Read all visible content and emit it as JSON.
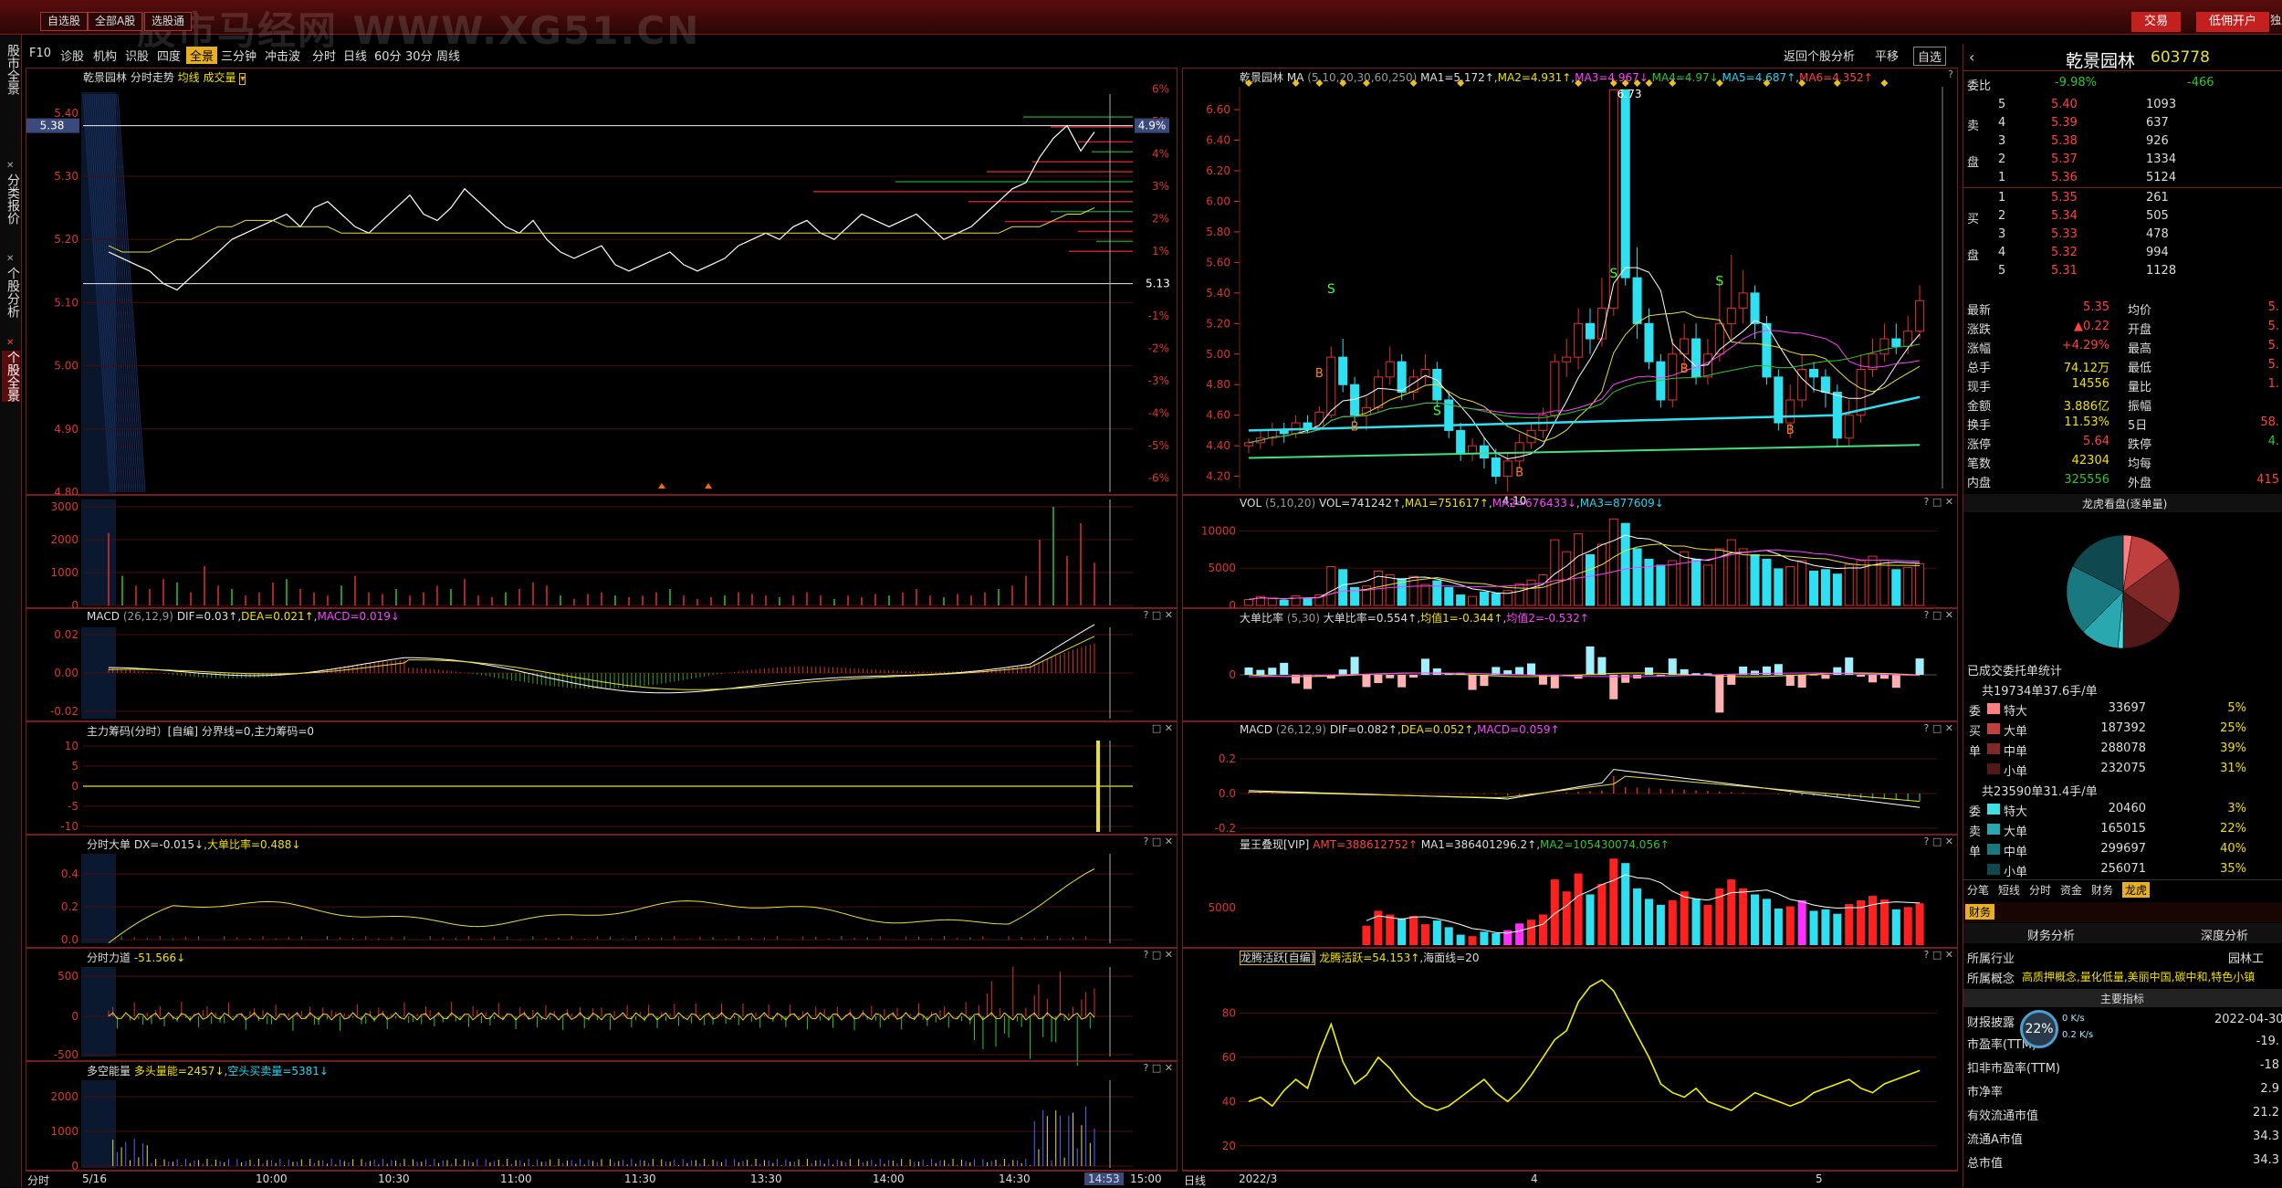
{
  "topbar": {
    "watermark": "股市马经网 WWW.XG51.CN",
    "btn_zixuan": "自选股",
    "btn_quanbu": "全部A股",
    "btn_yingxiao": "选股通",
    "btn_jiaoyi": "交易",
    "btn_kaihu": "低佣开户",
    "btn_more": "独立"
  },
  "lefttabs": {
    "tab1": "股市全景",
    "tab2": "分类报价",
    "tab3": "个股分析",
    "tab4": "个股全景"
  },
  "toolbar": {
    "items": [
      "F10",
      "诊股",
      "机构",
      "识股",
      "四度",
      "全景",
      "三分钟",
      "冲击波",
      "分时",
      "日线",
      "60分",
      "30分",
      "周线"
    ],
    "selected": "全景",
    "return": "返回个股分析",
    "pingyi": "平移",
    "zixuan": "自选"
  },
  "intraday": {
    "title": "乾景园林 分时走势",
    "sub": "均线 成交量",
    "price_labels": [
      "5.40",
      "5.30",
      "5.20",
      "5.10",
      "5.00",
      "4.90",
      "4.80"
    ],
    "current_price_tag": "5.38",
    "pct_labels": [
      "6%",
      "5%",
      "4%",
      "3%",
      "2%",
      "1%",
      "-1%",
      "-2%",
      "-3%",
      "-4%",
      "-5%",
      "-6%"
    ],
    "pct_tag": "4.9%",
    "ref_price": "5.13",
    "ref_price_val": 5.13,
    "price_series": [
      5.18,
      5.17,
      5.16,
      5.15,
      5.13,
      5.12,
      5.14,
      5.16,
      5.18,
      5.2,
      5.21,
      5.22,
      5.23,
      5.24,
      5.22,
      5.25,
      5.26,
      5.24,
      5.22,
      5.21,
      5.23,
      5.25,
      5.27,
      5.24,
      5.23,
      5.25,
      5.28,
      5.26,
      5.24,
      5.22,
      5.21,
      5.23,
      5.2,
      5.18,
      5.17,
      5.18,
      5.19,
      5.16,
      5.15,
      5.16,
      5.17,
      5.18,
      5.16,
      5.15,
      5.16,
      5.17,
      5.19,
      5.2,
      5.21,
      5.2,
      5.22,
      5.23,
      5.21,
      5.2,
      5.22,
      5.24,
      5.23,
      5.22,
      5.23,
      5.24,
      5.22,
      5.2,
      5.21,
      5.22,
      5.24,
      5.26,
      5.28,
      5.29,
      5.33,
      5.36,
      5.38,
      5.34,
      5.37
    ],
    "avg_series": [
      5.19,
      5.18,
      5.18,
      5.18,
      5.19,
      5.2,
      5.2,
      5.21,
      5.22,
      5.22,
      5.23,
      5.23,
      5.23,
      5.22,
      5.22,
      5.22,
      5.22,
      5.21,
      5.21,
      5.21,
      5.21,
      5.21,
      5.21,
      5.21,
      5.21,
      5.21,
      5.21,
      5.21,
      5.21,
      5.21,
      5.21,
      5.21,
      5.21,
      5.21,
      5.21,
      5.21,
      5.21,
      5.21,
      5.21,
      5.21,
      5.21,
      5.21,
      5.21,
      5.21,
      5.21,
      5.21,
      5.21,
      5.21,
      5.21,
      5.21,
      5.21,
      5.21,
      5.21,
      5.21,
      5.21,
      5.21,
      5.21,
      5.21,
      5.21,
      5.21,
      5.21,
      5.21,
      5.21,
      5.21,
      5.21,
      5.21,
      5.22,
      5.22,
      5.22,
      5.23,
      5.24,
      5.24,
      5.25
    ],
    "vol_labels": [
      "3000",
      "2000",
      "1000",
      "0"
    ],
    "vol_ylim": 3000,
    "vol_series": [
      2200,
      900,
      600,
      500,
      800,
      700,
      400,
      1200,
      600,
      500,
      300,
      400,
      700,
      800,
      500,
      400,
      300,
      600,
      900,
      400,
      350,
      500,
      300,
      400,
      600,
      500,
      800,
      300,
      250,
      400,
      500,
      700,
      600,
      300,
      200,
      350,
      400,
      300,
      250,
      300,
      400,
      500,
      300,
      200,
      250,
      300,
      400,
      350,
      300,
      250,
      300,
      400,
      300,
      200,
      300,
      250,
      350,
      300,
      400,
      500,
      300,
      250,
      350,
      300,
      400,
      500,
      600,
      900,
      2000,
      3000,
      1500,
      2500,
      1300
    ],
    "macd_title": "MACD",
    "macd_params": "(26,12,9)",
    "macd_dif": "DIF=0.03↑",
    "macd_dea": "DEA=0.021↑",
    "macd_val": "MACD=0.019↓",
    "macd_labels": [
      "0.02",
      "0.00",
      "-0.02"
    ],
    "zl_title": "主力筹码(分时）[自编]",
    "zl_sub": "分界线=0,主力筹码=0",
    "zl_labels": [
      "10",
      "5",
      "0",
      "-5",
      "-10"
    ],
    "dd_title": "分时大单",
    "dd_dx": "DX=-0.015↓",
    "dd_bili": "大单比率=0.488↓",
    "dd_labels": [
      "0.4",
      "0.2",
      "0.0"
    ],
    "ld_title": "分时力道",
    "ld_val": "-51.566↓",
    "ld_labels": [
      "500",
      "0",
      "-500"
    ],
    "dk_title": "多空能量",
    "dk_val": "多头量能=2457↓",
    "dk_kong": "空头买卖量=5381↓",
    "dk_labels": [
      "2000",
      "1000",
      "0"
    ],
    "time_labels": [
      "5/16",
      "10:00",
      "10:30",
      "11:00",
      "11:30",
      "13:30",
      "14:00",
      "14:30",
      "14:53",
      "15:00"
    ],
    "time_prefix": "分时"
  },
  "daily": {
    "title": "乾景园林",
    "ma_label": "MA",
    "ma_params": "(5,10,20,30,60,250)",
    "ma1": "MA1=5.172↑",
    "ma2": "MA2=4.931↑",
    "ma3": "MA3=4.967↓",
    "ma4": "MA4=4.97↓",
    "ma5": "MA5=4.687↑",
    "ma6": "MA6=4.352↑",
    "price_labels": [
      "6.60",
      "6.40",
      "6.20",
      "6.00",
      "5.80",
      "5.60",
      "5.40",
      "5.20",
      "5.00",
      "4.80",
      "4.60",
      "4.40",
      "4.20"
    ],
    "high_mark": "6.73",
    "low_mark": "4.10",
    "vol_title": "VOL",
    "vol_params": "(5,10,20)",
    "vol_val": "VOL=741242↑",
    "vol_ma1": "MA1=751617↑",
    "vol_ma2": "MA2=676433↓",
    "vol_ma3": "MA3=877609↓",
    "vol_labels": [
      "10000",
      "5000",
      "0"
    ],
    "dd_title": "大单比率",
    "dd_params": "(5,30)",
    "dd_val": "大单比率=0.554↑",
    "dd_j1": "均值1=-0.344↑",
    "dd_j2": "均值2=-0.532↑",
    "dd_labels": [
      "0"
    ],
    "macd_title": "MACD",
    "macd_params": "(26,12,9)",
    "macd_dif": "DIF=0.082↑",
    "macd_dea": "DEA=0.052↑",
    "macd_val": "MACD=0.059↑",
    "macd_labels": [
      "0.2",
      "0.0",
      "-0.2"
    ],
    "lw_title": "量王叠现[VIP]",
    "lw_amt": "AMT=388612752↑",
    "lw_ma1": "MA1=386401296.2↑",
    "lw_ma2": "MA2=105430074.056↑",
    "lw_labels": [
      "5000"
    ],
    "lt_title": "龙腾活跃[自编]",
    "lt_val": "龙腾活跃=54.153↑",
    "lt_sea": "海面线=20",
    "lt_labels": [
      "80",
      "60",
      "40",
      "20"
    ],
    "date_labels": [
      "2022/3",
      "4",
      "5"
    ],
    "date_prefix": "日线",
    "candles": [
      [
        4.4,
        4.42,
        4.35,
        4.45
      ],
      [
        4.42,
        4.45,
        4.38,
        4.5
      ],
      [
        4.45,
        4.5,
        4.4,
        4.55
      ],
      [
        4.5,
        4.48,
        4.42,
        4.55
      ],
      [
        4.48,
        4.55,
        4.45,
        4.6
      ],
      [
        4.55,
        4.52,
        4.48,
        4.6
      ],
      [
        4.52,
        4.62,
        4.5,
        4.66
      ],
      [
        4.6,
        4.98,
        4.58,
        5.05
      ],
      [
        4.98,
        4.8,
        4.75,
        5.1
      ],
      [
        4.8,
        4.6,
        4.55,
        4.85
      ],
      [
        4.6,
        4.65,
        4.5,
        4.72
      ],
      [
        4.65,
        4.85,
        4.62,
        4.9
      ],
      [
        4.85,
        4.95,
        4.8,
        5.05
      ],
      [
        4.95,
        4.75,
        4.7,
        5.0
      ],
      [
        4.75,
        4.85,
        4.7,
        4.9
      ],
      [
        4.85,
        4.9,
        4.8,
        5.0
      ],
      [
        4.9,
        4.7,
        4.65,
        4.95
      ],
      [
        4.7,
        4.5,
        4.45,
        4.75
      ],
      [
        4.5,
        4.35,
        4.3,
        4.55
      ],
      [
        4.35,
        4.4,
        4.3,
        4.45
      ],
      [
        4.4,
        4.32,
        4.25,
        4.45
      ],
      [
        4.32,
        4.2,
        4.15,
        4.38
      ],
      [
        4.2,
        4.3,
        4.1,
        4.35
      ],
      [
        4.3,
        4.42,
        4.25,
        4.48
      ],
      [
        4.42,
        4.5,
        4.38,
        4.55
      ],
      [
        4.5,
        4.6,
        4.45,
        4.65
      ],
      [
        4.6,
        4.95,
        4.58,
        5.0
      ],
      [
        4.95,
        4.98,
        4.85,
        5.1
      ],
      [
        4.98,
        5.2,
        4.9,
        5.3
      ],
      [
        5.2,
        5.1,
        5.0,
        5.3
      ],
      [
        5.1,
        5.3,
        5.05,
        5.5
      ],
      [
        5.3,
        6.73,
        5.25,
        6.73
      ],
      [
        6.73,
        5.5,
        5.45,
        6.73
      ],
      [
        5.5,
        5.2,
        5.1,
        5.7
      ],
      [
        5.2,
        4.95,
        4.9,
        5.3
      ],
      [
        4.95,
        4.7,
        4.65,
        5.0
      ],
      [
        4.7,
        5.0,
        4.65,
        5.1
      ],
      [
        5.0,
        5.1,
        4.9,
        5.2
      ],
      [
        5.1,
        4.85,
        4.8,
        5.2
      ],
      [
        4.85,
        5.0,
        4.8,
        5.1
      ],
      [
        5.0,
        5.2,
        4.95,
        5.5
      ],
      [
        5.2,
        5.3,
        5.1,
        5.65
      ],
      [
        5.3,
        5.4,
        5.2,
        5.55
      ],
      [
        5.4,
        5.2,
        5.1,
        5.45
      ],
      [
        5.2,
        4.85,
        4.8,
        5.25
      ],
      [
        4.85,
        4.55,
        4.5,
        4.9
      ],
      [
        4.55,
        4.7,
        4.45,
        4.8
      ],
      [
        4.7,
        4.9,
        4.65,
        5.0
      ],
      [
        4.9,
        4.85,
        4.75,
        4.95
      ],
      [
        4.85,
        4.75,
        4.65,
        4.9
      ],
      [
        4.75,
        4.45,
        4.4,
        4.8
      ],
      [
        4.45,
        4.6,
        4.4,
        4.7
      ],
      [
        4.6,
        4.9,
        4.55,
        5.0
      ],
      [
        4.9,
        5.0,
        4.85,
        5.1
      ],
      [
        5.0,
        5.1,
        4.95,
        5.2
      ],
      [
        5.1,
        5.05,
        5.0,
        5.2
      ],
      [
        5.05,
        5.15,
        5.0,
        5.25
      ],
      [
        5.15,
        5.35,
        5.1,
        5.45
      ]
    ],
    "vol": [
      800,
      1200,
      900,
      700,
      1300,
      1000,
      1400,
      5200,
      4800,
      2400,
      2600,
      4600,
      4100,
      3600,
      3900,
      2800,
      3300,
      2400,
      1400,
      1200,
      1800,
      1600,
      2000,
      2900,
      3400,
      4100,
      8800,
      7200,
      9600,
      6800,
      8200,
      11600,
      11000,
      7600,
      6200,
      5400,
      6000,
      7200,
      6200,
      5400,
      7600,
      8800,
      7600,
      6800,
      6200,
      4900,
      5200,
      6000,
      4600,
      4800,
      4200,
      5500,
      6000,
      6600,
      6100,
      4800,
      5100,
      5600
    ],
    "lt": [
      40,
      42,
      38,
      45,
      50,
      46,
      62,
      75,
      58,
      48,
      52,
      60,
      55,
      48,
      42,
      38,
      36,
      38,
      42,
      46,
      50,
      44,
      40,
      45,
      52,
      60,
      68,
      72,
      85,
      92,
      95,
      90,
      80,
      70,
      60,
      48,
      44,
      42,
      46,
      40,
      38,
      36,
      40,
      44,
      42,
      40,
      38,
      40,
      44,
      46,
      48,
      50,
      46,
      44,
      48,
      50,
      52,
      54
    ]
  },
  "quote": {
    "name": "乾景园林",
    "code": "603778",
    "weibi_label": "委比",
    "weibi_val": "-9.98%",
    "weicha": "-466",
    "sell": [
      [
        "5.40",
        "1093"
      ],
      [
        "5.39",
        "637"
      ],
      [
        "5.38",
        "926"
      ],
      [
        "5.37",
        "1334"
      ],
      [
        "5.36",
        "5124"
      ]
    ],
    "buy": [
      [
        "5.35",
        "261"
      ],
      [
        "5.34",
        "505"
      ],
      [
        "5.33",
        "478"
      ],
      [
        "5.32",
        "994"
      ],
      [
        "5.31",
        "1128"
      ]
    ],
    "sell_lbl": "卖",
    "buy_lbl": "买",
    "pan": "盘",
    "f_zuixin": "最新",
    "v_zuixin": "5.35",
    "f_junjia": "均价",
    "v_junjia": "5.",
    "f_zhangdie": "涨跌",
    "v_zhangdie": "▲0.22",
    "f_kaipan": "开盘",
    "v_kaipan": "5.",
    "f_zhangfu": "涨幅",
    "v_zhangfu": "+4.29%",
    "f_zuigao": "最高",
    "v_zuigao": "5.",
    "f_zongshou": "总手",
    "v_zongshou": "74.12万",
    "f_zuidi": "最低",
    "v_zuidi": "5.",
    "f_xianshou": "现手",
    "v_xianshou": "14556",
    "f_liangbi": "量比",
    "v_liangbi": "1.",
    "f_jine": "金额",
    "v_jine": "3.886亿",
    "f_zhenfu": "振幅",
    "v_zhenfu": "",
    "f_huanshou": "换手",
    "v_huanshou": "11.53%",
    "f_5ri": "5日",
    "v_5ri": "58.",
    "f_zhangting": "涨停",
    "v_zhangting": "5.64",
    "f_dieting": "跌停",
    "v_dieting": "4.",
    "f_bishu": "笔数",
    "v_bishu": "42304",
    "f_junliang": "均每",
    "v_junliang": "",
    "f_neipan": "内盘",
    "v_neipan": "325556",
    "f_waipan": "外盘",
    "v_waipan": "415",
    "lhk_title": "龙虎看盘(逐单量)",
    "pie": [
      0.05,
      0.25,
      0.39,
      0.31,
      0.03,
      0.22,
      0.4,
      0.35
    ],
    "ycj_title": "已成交委托单统计",
    "buy_total": "共19734单37.6手/单",
    "buy_grp": [
      "委",
      "买",
      "单"
    ],
    "buy_rows": [
      [
        "特大",
        "33697",
        "5%"
      ],
      [
        "大单",
        "187392",
        "25%"
      ],
      [
        "中单",
        "288078",
        "39%"
      ],
      [
        "小单",
        "232075",
        "31%"
      ]
    ],
    "sell_total": "共23590单31.4手/单",
    "sell_grp": [
      "委",
      "卖",
      "单"
    ],
    "sell_rows": [
      [
        "特大",
        "20460",
        "3%"
      ],
      [
        "大单",
        "165015",
        "22%"
      ],
      [
        "中单",
        "299697",
        "40%"
      ],
      [
        "小单",
        "256071",
        "35%"
      ]
    ],
    "subtabs": [
      "分笔",
      "短线",
      "分时",
      "资金",
      "财务",
      "龙虎"
    ],
    "sub_selected": "龙虎",
    "cw_tab": "财务",
    "cw_t1": "财务分析",
    "cw_t2": "深度分析",
    "hy_label": "所属行业",
    "hy_val": "园林工",
    "gn_label": "所属概念",
    "gn_val": "高质押概念,量化低量,美丽中国,碳中和,特色小镇",
    "zyzb": "主要指标",
    "bq_label": "财报披露",
    "bq_val": "2022-04-30",
    "rows": [
      [
        "市盈率(TTM)",
        "-19."
      ],
      [
        "扣非市盈率(TTM)",
        "-18"
      ],
      [
        "市净率",
        "2.9"
      ],
      [
        "有效流通市值",
        "21.2"
      ],
      [
        "流通A市值",
        "34.3"
      ],
      [
        "总市值",
        "34.3"
      ]
    ],
    "speed_pct": "22%",
    "up": "0 K/s",
    "down": "0.2 K/s"
  }
}
